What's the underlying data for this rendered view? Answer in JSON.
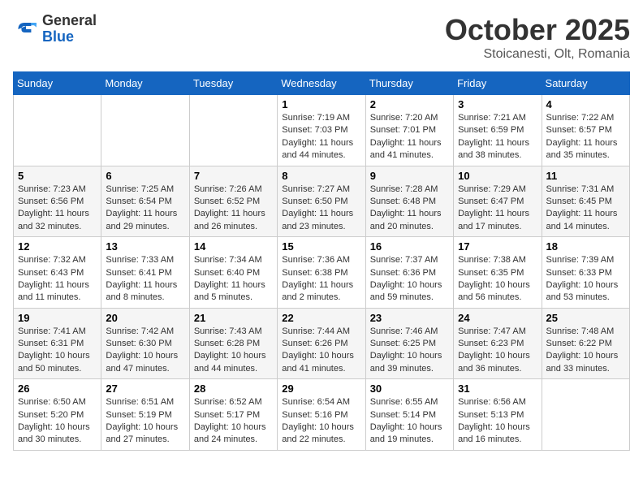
{
  "header": {
    "logo_general": "General",
    "logo_blue": "Blue",
    "month_title": "October 2025",
    "location": "Stoicanesti, Olt, Romania"
  },
  "weekdays": [
    "Sunday",
    "Monday",
    "Tuesday",
    "Wednesday",
    "Thursday",
    "Friday",
    "Saturday"
  ],
  "weeks": [
    [
      {
        "day": "",
        "info": ""
      },
      {
        "day": "",
        "info": ""
      },
      {
        "day": "",
        "info": ""
      },
      {
        "day": "1",
        "info": "Sunrise: 7:19 AM\nSunset: 7:03 PM\nDaylight: 11 hours and 44 minutes."
      },
      {
        "day": "2",
        "info": "Sunrise: 7:20 AM\nSunset: 7:01 PM\nDaylight: 11 hours and 41 minutes."
      },
      {
        "day": "3",
        "info": "Sunrise: 7:21 AM\nSunset: 6:59 PM\nDaylight: 11 hours and 38 minutes."
      },
      {
        "day": "4",
        "info": "Sunrise: 7:22 AM\nSunset: 6:57 PM\nDaylight: 11 hours and 35 minutes."
      }
    ],
    [
      {
        "day": "5",
        "info": "Sunrise: 7:23 AM\nSunset: 6:56 PM\nDaylight: 11 hours and 32 minutes."
      },
      {
        "day": "6",
        "info": "Sunrise: 7:25 AM\nSunset: 6:54 PM\nDaylight: 11 hours and 29 minutes."
      },
      {
        "day": "7",
        "info": "Sunrise: 7:26 AM\nSunset: 6:52 PM\nDaylight: 11 hours and 26 minutes."
      },
      {
        "day": "8",
        "info": "Sunrise: 7:27 AM\nSunset: 6:50 PM\nDaylight: 11 hours and 23 minutes."
      },
      {
        "day": "9",
        "info": "Sunrise: 7:28 AM\nSunset: 6:48 PM\nDaylight: 11 hours and 20 minutes."
      },
      {
        "day": "10",
        "info": "Sunrise: 7:29 AM\nSunset: 6:47 PM\nDaylight: 11 hours and 17 minutes."
      },
      {
        "day": "11",
        "info": "Sunrise: 7:31 AM\nSunset: 6:45 PM\nDaylight: 11 hours and 14 minutes."
      }
    ],
    [
      {
        "day": "12",
        "info": "Sunrise: 7:32 AM\nSunset: 6:43 PM\nDaylight: 11 hours and 11 minutes."
      },
      {
        "day": "13",
        "info": "Sunrise: 7:33 AM\nSunset: 6:41 PM\nDaylight: 11 hours and 8 minutes."
      },
      {
        "day": "14",
        "info": "Sunrise: 7:34 AM\nSunset: 6:40 PM\nDaylight: 11 hours and 5 minutes."
      },
      {
        "day": "15",
        "info": "Sunrise: 7:36 AM\nSunset: 6:38 PM\nDaylight: 11 hours and 2 minutes."
      },
      {
        "day": "16",
        "info": "Sunrise: 7:37 AM\nSunset: 6:36 PM\nDaylight: 10 hours and 59 minutes."
      },
      {
        "day": "17",
        "info": "Sunrise: 7:38 AM\nSunset: 6:35 PM\nDaylight: 10 hours and 56 minutes."
      },
      {
        "day": "18",
        "info": "Sunrise: 7:39 AM\nSunset: 6:33 PM\nDaylight: 10 hours and 53 minutes."
      }
    ],
    [
      {
        "day": "19",
        "info": "Sunrise: 7:41 AM\nSunset: 6:31 PM\nDaylight: 10 hours and 50 minutes."
      },
      {
        "day": "20",
        "info": "Sunrise: 7:42 AM\nSunset: 6:30 PM\nDaylight: 10 hours and 47 minutes."
      },
      {
        "day": "21",
        "info": "Sunrise: 7:43 AM\nSunset: 6:28 PM\nDaylight: 10 hours and 44 minutes."
      },
      {
        "day": "22",
        "info": "Sunrise: 7:44 AM\nSunset: 6:26 PM\nDaylight: 10 hours and 41 minutes."
      },
      {
        "day": "23",
        "info": "Sunrise: 7:46 AM\nSunset: 6:25 PM\nDaylight: 10 hours and 39 minutes."
      },
      {
        "day": "24",
        "info": "Sunrise: 7:47 AM\nSunset: 6:23 PM\nDaylight: 10 hours and 36 minutes."
      },
      {
        "day": "25",
        "info": "Sunrise: 7:48 AM\nSunset: 6:22 PM\nDaylight: 10 hours and 33 minutes."
      }
    ],
    [
      {
        "day": "26",
        "info": "Sunrise: 6:50 AM\nSunset: 5:20 PM\nDaylight: 10 hours and 30 minutes."
      },
      {
        "day": "27",
        "info": "Sunrise: 6:51 AM\nSunset: 5:19 PM\nDaylight: 10 hours and 27 minutes."
      },
      {
        "day": "28",
        "info": "Sunrise: 6:52 AM\nSunset: 5:17 PM\nDaylight: 10 hours and 24 minutes."
      },
      {
        "day": "29",
        "info": "Sunrise: 6:54 AM\nSunset: 5:16 PM\nDaylight: 10 hours and 22 minutes."
      },
      {
        "day": "30",
        "info": "Sunrise: 6:55 AM\nSunset: 5:14 PM\nDaylight: 10 hours and 19 minutes."
      },
      {
        "day": "31",
        "info": "Sunrise: 6:56 AM\nSunset: 5:13 PM\nDaylight: 10 hours and 16 minutes."
      },
      {
        "day": "",
        "info": ""
      }
    ]
  ]
}
